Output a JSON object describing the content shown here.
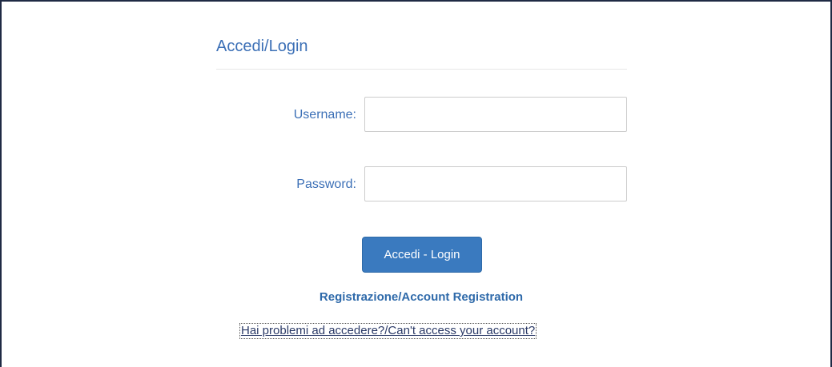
{
  "login_form": {
    "title": "Accedi/Login",
    "username_label": "Username:",
    "username_value": "",
    "password_label": "Password:",
    "password_value": "",
    "submit_label": "Accedi - Login",
    "register_link": "Registrazione/Account Registration",
    "help_link": "Hai problemi ad accedere?/Can't access your account?"
  },
  "colors": {
    "heading": "#3b6fb6",
    "button": "#3a7abf",
    "link": "#2f6aaa"
  }
}
